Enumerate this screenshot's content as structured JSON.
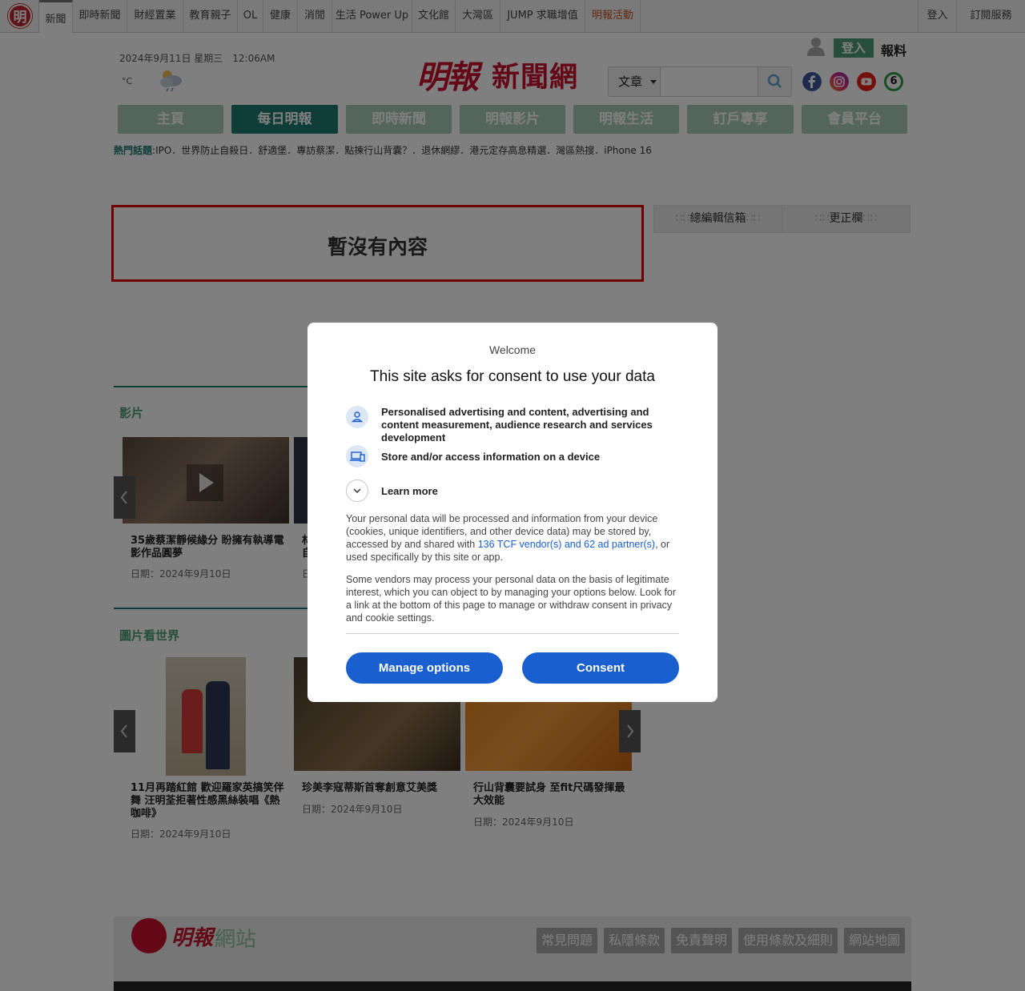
{
  "topnav": {
    "items": [
      "新聞",
      "即時新聞",
      "財經置業",
      "教育親子",
      "OL",
      "健康",
      "消閒",
      "生活 Power Up",
      "文化館",
      "大灣區",
      "JUMP 求職增值",
      "明報活動"
    ],
    "logo_char": "明",
    "login": "登入",
    "subscribe": "訂閱服務"
  },
  "header": {
    "datetime": "2024年9月11日 星期三　12:06AM",
    "temp": "°C",
    "brand_script": "明報",
    "brand_text": "新聞網",
    "login": "登入",
    "report": "報料",
    "search": {
      "type_selected": "文章",
      "placeholder": ""
    },
    "social_icons": [
      "facebook-icon",
      "instagram-icon",
      "youtube-icon",
      "six-icon"
    ],
    "six_label": "6"
  },
  "mainnav": [
    "主頁",
    "每日明報",
    "即時新聞",
    "明報影片",
    "明報生活",
    "訂戶專享",
    "會員平台"
  ],
  "hot": {
    "label": "熱門話題",
    "items": "IPO．世界防止自殺日．舒適堡．專訪蔡潔．點揀行山背囊？．退休網繆．港元定存高息精選．灣區熱搜．iPhone 16"
  },
  "main": {
    "empty_text": "暫沒有內容",
    "tabs": [
      "總編輯信箱",
      "更正欄"
    ]
  },
  "video": {
    "title": "影片",
    "items": [
      {
        "caption": "35歲蔡潔靜候緣分 盼擁有執導電影作品圓夢",
        "date": "日期：2024年9月10日"
      },
      {
        "caption": "林",
        "caption2": "自",
        "date": "日"
      }
    ]
  },
  "photo": {
    "title": "圖片看世界",
    "items": [
      {
        "caption": "11月再踏紅館 歡迎羅家英搞笑伴舞 汪明荃拒著性感黑絲裝唱《熱咖啡》",
        "date": "日期：2024年9月10日"
      },
      {
        "caption": "珍美李寇蒂斯首奪創意艾美獎",
        "date": "日期：2024年9月10日"
      },
      {
        "caption": "行山背囊要試身 至fit尺碼發揮最大效能",
        "date": "日期：2024年9月10日"
      }
    ]
  },
  "footer": {
    "logo_script": "明報",
    "logo_text": "網站",
    "links": [
      "常見問題",
      "私隱條款",
      "免責聲明",
      "使用條款及細則",
      "網站地圖"
    ]
  },
  "consent": {
    "welcome": "Welcome",
    "title": "This site asks for consent to use your data",
    "purpose1": "Personalised advertising and content, advertising and content measurement, audience research and services development",
    "purpose2": "Store and/or access information on a device",
    "learn_more": "Learn more",
    "para1_pre": "Your personal data will be processed and information from your device (cookies, unique identifiers, and other device data) may be stored by, accessed by and shared with ",
    "para1_link": "136 TCF vendor(s) and 62 ad partner(s)",
    "para1_post": ", or used specifically by this site or app.",
    "para2": "Some vendors may process your personal data on the basis of legitimate interest, which you can object to by managing your options below. Look for a link at the bottom of this page to manage or withdraw consent in privacy and cookie settings.",
    "manage": "Manage options",
    "consent": "Consent"
  },
  "colors": {
    "brand_red": "#c8102e",
    "nav_green": "#1e7b6e",
    "nav_light_green": "#a6cbb8",
    "consent_blue": "#1a5fcf"
  }
}
